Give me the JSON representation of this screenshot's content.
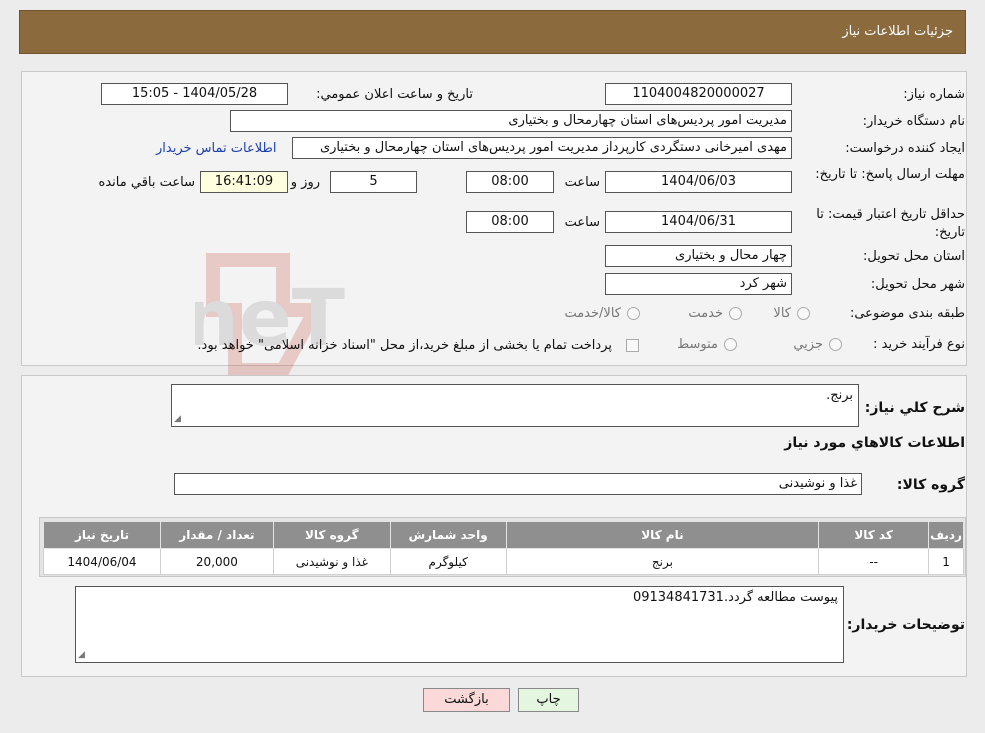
{
  "header": {
    "title": "جزئیات اطلاعات نیاز"
  },
  "details": {
    "need_number_label": "شماره نیاز:",
    "need_number": "1104004820000027",
    "announce_label": "تاريخ و ساعت اعلان عمومي:",
    "announce_value": "1404/05/28 - 15:05",
    "buyer_org_label": "نام دستگاه خريدار:",
    "buyer_org": "مديريت امور پرديس‌های استان چهارمحال و بختياری",
    "creator_label": "ايجاد کننده درخواست:",
    "creator": "مهدی اميرخانی دستگردی کارپرداز مديريت امور پرديس‌های استان چهارمحال و بختياری",
    "contact_link": "اطلاعات تماس خريدار",
    "deadline_label": "مهلت ارسال پاسخ: تا تاريخ:",
    "deadline_date": "1404/06/03",
    "time_label": "ساعت",
    "deadline_time": "08:00",
    "days_value": "5",
    "days_label": "روز و",
    "remaining_time": "16:41:09",
    "remaining_label": "ساعت باقي مانده",
    "validity_label": "حداقل تاريخ اعتبار قيمت: تا تاريخ:",
    "validity_date": "1404/06/31",
    "validity_time": "08:00",
    "province_label": "استان محل تحويل:",
    "province": "چهار محال و بختياری",
    "city_label": "شهر محل تحويل:",
    "city": "شهر کرد",
    "category_label": "طبقه بندی موضوعی:",
    "category_options": [
      "کالا",
      "خدمت",
      "کالا/خدمت"
    ],
    "process_label": "نوع فرآيند خريد :",
    "process_options": [
      "جزيي",
      "متوسط"
    ],
    "payment_note": "پرداخت تمام يا بخشی از مبلغ خريد،از محل \"اسناد خزانه اسلامی\" خواهد بود."
  },
  "description": {
    "label": "شرح كلي نياز:",
    "value": "برنج."
  },
  "goods_section": {
    "title": "اطلاعات كالاهاي مورد نياز",
    "group_label": "گروه كالا:",
    "group_value": "غذا و نوشيدنی"
  },
  "table": {
    "headers": [
      "رديف",
      "كد كالا",
      "نام كالا",
      "واحد شمارش",
      "گروه كالا",
      "تعداد / مقدار",
      "تاريخ نياز"
    ],
    "rows": [
      [
        "1",
        "--",
        "برنج",
        "کيلوگرم",
        "غذا و نوشيدنی",
        "20,000",
        "1404/06/04"
      ]
    ]
  },
  "buyer_notes": {
    "label": "توضيحات خريدار:",
    "value": "پيوست مطالعه گردد.09134841731"
  },
  "buttons": {
    "back": "بازگشت",
    "print": "چاپ"
  },
  "watermark": {
    "text": "AriaTender.neT"
  }
}
